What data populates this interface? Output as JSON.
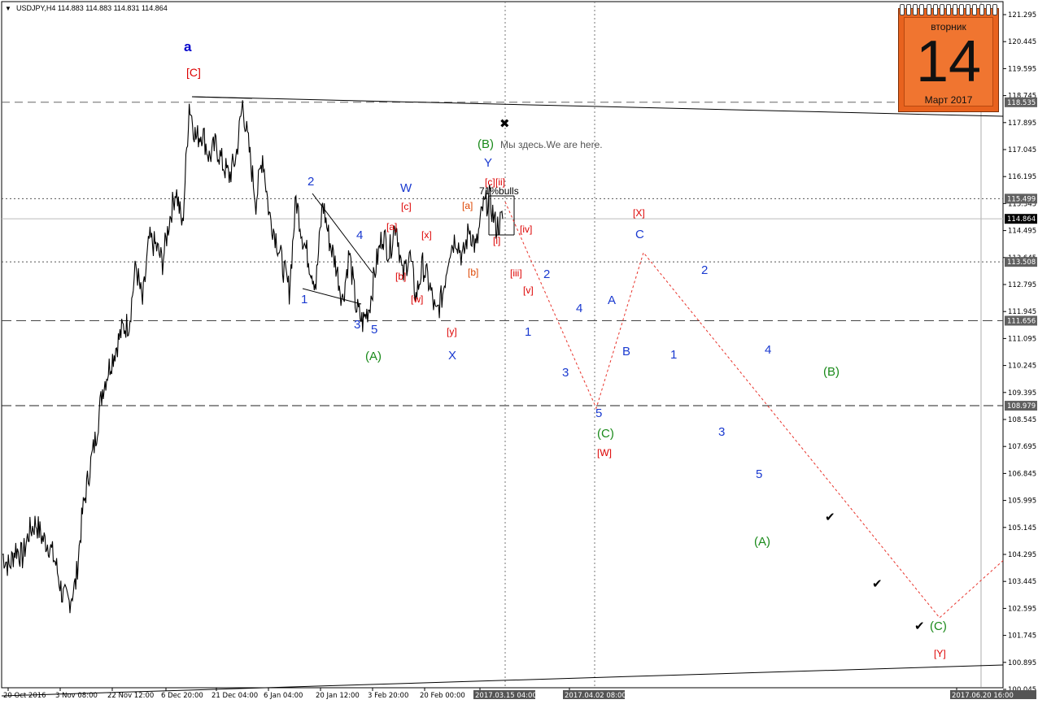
{
  "header": {
    "arrow": "▼",
    "text": "USDJPY,H4  114.883 114.883 114.831 114.864"
  },
  "calendar": {
    "weekday": "вторник",
    "day": "14",
    "month": "Март 2017"
  },
  "chart_data": {
    "type": "line",
    "symbol": "USDJPY",
    "timeframe": "H4",
    "ohlc_last": {
      "open": 114.883,
      "high": 114.883,
      "low": 114.831,
      "close": 114.864
    },
    "ylim": [
      100.0,
      121.5
    ],
    "y_ticks": [
      "121.295",
      "120.445",
      "119.595",
      "118.745",
      "117.895",
      "117.045",
      "116.195",
      "115.345",
      "114.495",
      "113.645",
      "112.795",
      "111.945",
      "111.095",
      "110.245",
      "109.395",
      "108.545",
      "107.695",
      "106.845",
      "105.995",
      "105.145",
      "104.295",
      "103.445",
      "102.595",
      "101.745",
      "100.895",
      "100.045"
    ],
    "x_ticks": [
      "20 Oct 2016",
      "3 Nov 08:00",
      "22 Nov 12:00",
      "6 Dec 20:00",
      "21 Dec 04:00",
      "6 Jan 04:00",
      "20 Jan 12:00",
      "3 Feb 20:00",
      "20 Feb 00:00",
      "2017.03.15 04:00",
      "2017.04.02 08:00",
      "2017.06.20 16:00"
    ],
    "marked_levels": [
      "118.535",
      "115.499",
      "114.864",
      "113.508",
      "111.656",
      "108.979"
    ],
    "price_path": [
      {
        "t": "20 Oct 2016",
        "v": 104.3
      },
      {
        "t": "",
        "v": 103.9
      },
      {
        "t": "",
        "v": 104.5
      },
      {
        "t": "",
        "v": 104.2
      },
      {
        "t": "",
        "v": 105.0
      },
      {
        "t": "",
        "v": 105.3
      },
      {
        "t": "",
        "v": 104.8
      },
      {
        "t": "",
        "v": 104.6
      },
      {
        "t": "",
        "v": 104.0
      },
      {
        "t": "",
        "v": 103.0
      },
      {
        "t": "",
        "v": 102.8
      },
      {
        "t": "3 Nov 08:00",
        "v": 103.4
      },
      {
        "t": "",
        "v": 105.6
      },
      {
        "t": "",
        "v": 106.9
      },
      {
        "t": "",
        "v": 108.0
      },
      {
        "t": "",
        "v": 109.5
      },
      {
        "t": "",
        "v": 110.2
      },
      {
        "t": "",
        "v": 110.8
      },
      {
        "t": "",
        "v": 111.4
      },
      {
        "t": "22 Nov 12:00",
        "v": 111.6
      },
      {
        "t": "",
        "v": 113.4
      },
      {
        "t": "",
        "v": 112.2
      },
      {
        "t": "",
        "v": 114.2
      },
      {
        "t": "",
        "v": 114.0
      },
      {
        "t": "",
        "v": 113.5
      },
      {
        "t": "",
        "v": 114.8
      },
      {
        "t": "",
        "v": 115.8
      },
      {
        "t": "6 Dec 20:00",
        "v": 114.6
      },
      {
        "t": "",
        "v": 118.5
      },
      {
        "t": "",
        "v": 117.4
      },
      {
        "t": "",
        "v": 117.6
      },
      {
        "t": "",
        "v": 116.8
      },
      {
        "t": "",
        "v": 117.2
      },
      {
        "t": "",
        "v": 116.6
      },
      {
        "t": "21 Dec 04:00",
        "v": 116.2
      },
      {
        "t": "",
        "v": 116.8
      },
      {
        "t": "",
        "v": 118.5
      },
      {
        "t": "",
        "v": 117.0
      },
      {
        "t": "",
        "v": 115.4
      },
      {
        "t": "",
        "v": 116.9
      },
      {
        "t": "6 Jan 04:00",
        "v": 115.0
      },
      {
        "t": "",
        "v": 114.3
      },
      {
        "t": "",
        "v": 113.4
      },
      {
        "t": "",
        "v": 112.6
      },
      {
        "t": "",
        "v": 115.5
      },
      {
        "t": "",
        "v": 114.3
      },
      {
        "t": "",
        "v": 113.5
      },
      {
        "t": "20 Jan 12:00",
        "v": 112.8
      },
      {
        "t": "",
        "v": 115.4
      },
      {
        "t": "",
        "v": 114.2
      },
      {
        "t": "",
        "v": 113.4
      },
      {
        "t": "",
        "v": 112.3
      },
      {
        "t": "",
        "v": 113.8
      },
      {
        "t": "",
        "v": 112.1
      },
      {
        "t": "3 Feb 20:00",
        "v": 111.6
      },
      {
        "t": "",
        "v": 112.1
      },
      {
        "t": "",
        "v": 113.4
      },
      {
        "t": "",
        "v": 114.4
      },
      {
        "t": "",
        "v": 113.8
      },
      {
        "t": "",
        "v": 114.8
      },
      {
        "t": "",
        "v": 113.0
      },
      {
        "t": "",
        "v": 113.8
      },
      {
        "t": "",
        "v": 112.4
      },
      {
        "t": "",
        "v": 113.4
      },
      {
        "t": "20 Feb 00:00",
        "v": 112.8
      },
      {
        "t": "",
        "v": 111.8
      },
      {
        "t": "",
        "v": 112.5
      },
      {
        "t": "",
        "v": 113.9
      },
      {
        "t": "",
        "v": 114.3
      },
      {
        "t": "",
        "v": 113.6
      },
      {
        "t": "",
        "v": 114.6
      },
      {
        "t": "",
        "v": 113.9
      },
      {
        "t": "",
        "v": 115.2
      },
      {
        "t": "",
        "v": 115.5
      },
      {
        "t": "",
        "v": 114.6
      },
      {
        "t": "2017.03.15 04:00",
        "v": 114.86
      }
    ],
    "forecast_path": [
      {
        "t": "2017.03.15 04:00",
        "v": 115.4
      },
      {
        "t": "2017.04.02 08:00",
        "v": 108.9
      },
      {
        "t": "",
        "v": 113.8
      },
      {
        "t": "",
        "v": 102.3
      },
      {
        "t": "2017.06.20 16:00",
        "v": 104.1
      }
    ],
    "annotations": [
      {
        "text": "a",
        "color": "#0000cc",
        "bold": true
      },
      {
        "text": "[C]",
        "color": "#dd0000"
      },
      {
        "text": "Мы здесь.We are here.",
        "color": "#555555"
      },
      {
        "text": "(B)",
        "color": "#1a8a1a"
      },
      {
        "text": "Y",
        "color": "#1a3ad0"
      },
      {
        "text": "71%bulls",
        "color": "#000000"
      },
      {
        "text": "[c]",
        "color": "#dd0000"
      },
      {
        "text": "[ii]",
        "color": "#dd0000"
      },
      {
        "text": "W",
        "color": "#1a3ad0"
      },
      {
        "text": "[c]",
        "color": "#dd0000"
      },
      {
        "text": "[a]",
        "color": "#dd0000"
      },
      {
        "text": "[x]",
        "color": "#dd0000"
      },
      {
        "text": "[b]",
        "color": "#dd0000"
      },
      {
        "text": "[w]",
        "color": "#dd0000"
      },
      {
        "text": "[a]",
        "color": "#dd4400"
      },
      {
        "text": "[b]",
        "color": "#dd4400"
      },
      {
        "text": "[y]",
        "color": "#dd0000"
      },
      {
        "text": "X",
        "color": "#1a3ad0"
      },
      {
        "text": "[iv]",
        "color": "#dd0000"
      },
      {
        "text": "[i]",
        "color": "#dd0000"
      },
      {
        "text": "[iii]",
        "color": "#dd0000"
      },
      {
        "text": "[v]",
        "color": "#dd0000"
      },
      {
        "text": "2",
        "color": "#1a3ad0"
      },
      {
        "text": "4",
        "color": "#1a3ad0"
      },
      {
        "text": "1",
        "color": "#1a3ad0"
      },
      {
        "text": "3",
        "color": "#1a3ad0"
      },
      {
        "text": "5",
        "color": "#1a3ad0"
      },
      {
        "text": "(A)",
        "color": "#1a8a1a"
      },
      {
        "text": "2",
        "color": "#1a3ad0"
      },
      {
        "text": "4",
        "color": "#1a3ad0"
      },
      {
        "text": "1",
        "color": "#1a3ad0"
      },
      {
        "text": "3",
        "color": "#1a3ad0"
      },
      {
        "text": "A",
        "color": "#1a3ad0"
      },
      {
        "text": "B",
        "color": "#1a3ad0"
      },
      {
        "text": "5",
        "color": "#1a3ad0"
      },
      {
        "text": "(C)",
        "color": "#1a8a1a"
      },
      {
        "text": "[W]",
        "color": "#dd0000"
      },
      {
        "text": "[X]",
        "color": "#dd0000"
      },
      {
        "text": "C",
        "color": "#1a3ad0"
      },
      {
        "text": "2",
        "color": "#1a3ad0"
      },
      {
        "text": "1",
        "color": "#1a3ad0"
      },
      {
        "text": "4",
        "color": "#1a3ad0"
      },
      {
        "text": "(B)",
        "color": "#1a8a1a"
      },
      {
        "text": "3",
        "color": "#1a3ad0"
      },
      {
        "text": "5",
        "color": "#1a3ad0"
      },
      {
        "text": "(A)",
        "color": "#1a8a1a"
      },
      {
        "text": "(C)",
        "color": "#1a8a1a"
      },
      {
        "text": "[Y]",
        "color": "#dd0000"
      },
      {
        "text": "✔",
        "color": "#000000"
      },
      {
        "text": "✔",
        "color": "#000000"
      },
      {
        "text": "✔",
        "color": "#000000"
      },
      {
        "text": "✖",
        "color": "#000000"
      }
    ],
    "colors": {
      "price": "#000000",
      "forecast": "#e8322a",
      "level_label_bg": "#000000",
      "level_label_text": "#ffffff"
    },
    "grid": false
  }
}
